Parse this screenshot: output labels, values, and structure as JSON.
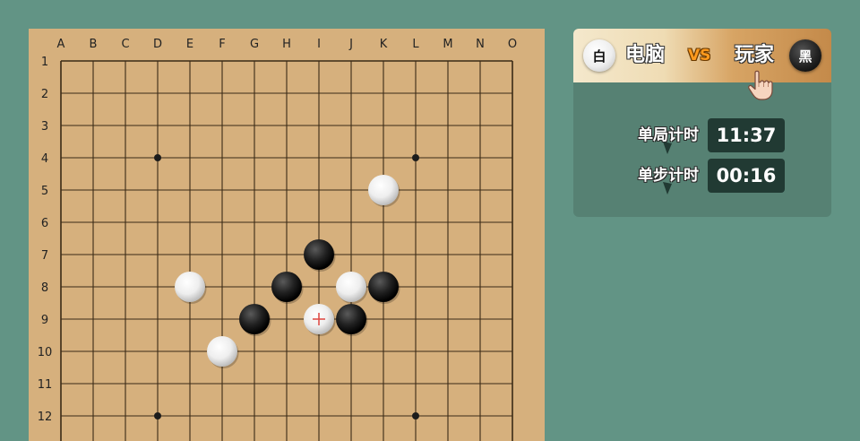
{
  "board": {
    "columns": [
      "A",
      "B",
      "C",
      "D",
      "E",
      "F",
      "G",
      "H",
      "I",
      "J",
      "K",
      "L",
      "M",
      "N",
      "O"
    ],
    "rows": [
      1,
      2,
      3,
      4,
      5,
      6,
      7,
      8,
      9,
      10,
      11,
      12
    ],
    "star_points": [
      {
        "col": "D",
        "row": 4
      },
      {
        "col": "L",
        "row": 4
      },
      {
        "col": "D",
        "row": 12
      },
      {
        "col": "L",
        "row": 12
      }
    ],
    "stones": [
      {
        "color": "white",
        "col": "K",
        "row": 5
      },
      {
        "color": "black",
        "col": "I",
        "row": 7
      },
      {
        "color": "white",
        "col": "E",
        "row": 8
      },
      {
        "color": "black",
        "col": "H",
        "row": 8
      },
      {
        "color": "white",
        "col": "J",
        "row": 8
      },
      {
        "color": "black",
        "col": "K",
        "row": 8
      },
      {
        "color": "black",
        "col": "G",
        "row": 9
      },
      {
        "color": "white",
        "col": "I",
        "row": 9,
        "last_move": true
      },
      {
        "color": "black",
        "col": "J",
        "row": 9
      },
      {
        "color": "white",
        "col": "F",
        "row": 10
      }
    ],
    "colors": {
      "background": "#d6b07d",
      "grid": "#3a2a16",
      "last_move_marker": "#e0504a"
    }
  },
  "panel": {
    "player_white": {
      "badge": "白",
      "name": "电脑"
    },
    "vs": "VS",
    "player_black": {
      "badge": "黑",
      "name": "玩家"
    },
    "current_turn_icon": "pointing-hand-icon",
    "game_timer": {
      "label": "单局计时",
      "value": "11:37"
    },
    "step_timer": {
      "label": "单步计时",
      "value": "00:16"
    }
  }
}
